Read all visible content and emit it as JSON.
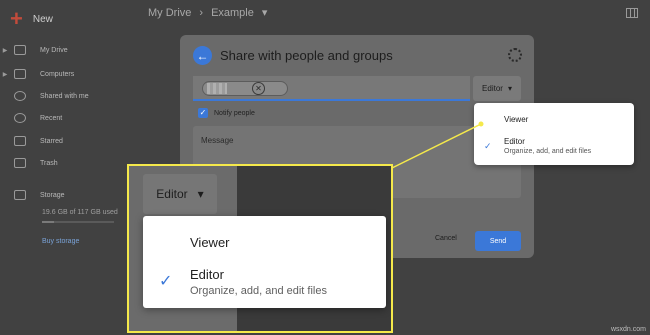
{
  "app": {
    "new_label": "New",
    "breadcrumb": [
      "My Drive",
      "Example"
    ],
    "sidebar": [
      {
        "label": "My Drive"
      },
      {
        "label": "Computers"
      },
      {
        "label": "Shared with me"
      },
      {
        "label": "Recent"
      },
      {
        "label": "Starred"
      },
      {
        "label": "Trash"
      },
      {
        "label": "Storage"
      }
    ],
    "storage_note": "19.6 GB of 117 GB used",
    "storage_fraction": 0.17,
    "buy_storage": "Buy storage"
  },
  "dialog": {
    "title": "Share with people and groups",
    "role_label": "Editor",
    "notify_label": "Notify people",
    "message_label": "Message",
    "cancel_label": "Cancel",
    "send_label": "Send"
  },
  "role_menu": {
    "viewer": "Viewer",
    "editor": "Editor",
    "editor_sub": "Organize, add, and edit files"
  },
  "zoom": {
    "role_label": "Editor",
    "viewer": "Viewer",
    "editor": "Editor",
    "editor_sub": "Organize, add, and edit files"
  },
  "colors": {
    "accent": "#3b78d8",
    "highlight": "#f5e94b"
  },
  "watermark": "wsxdn.com"
}
